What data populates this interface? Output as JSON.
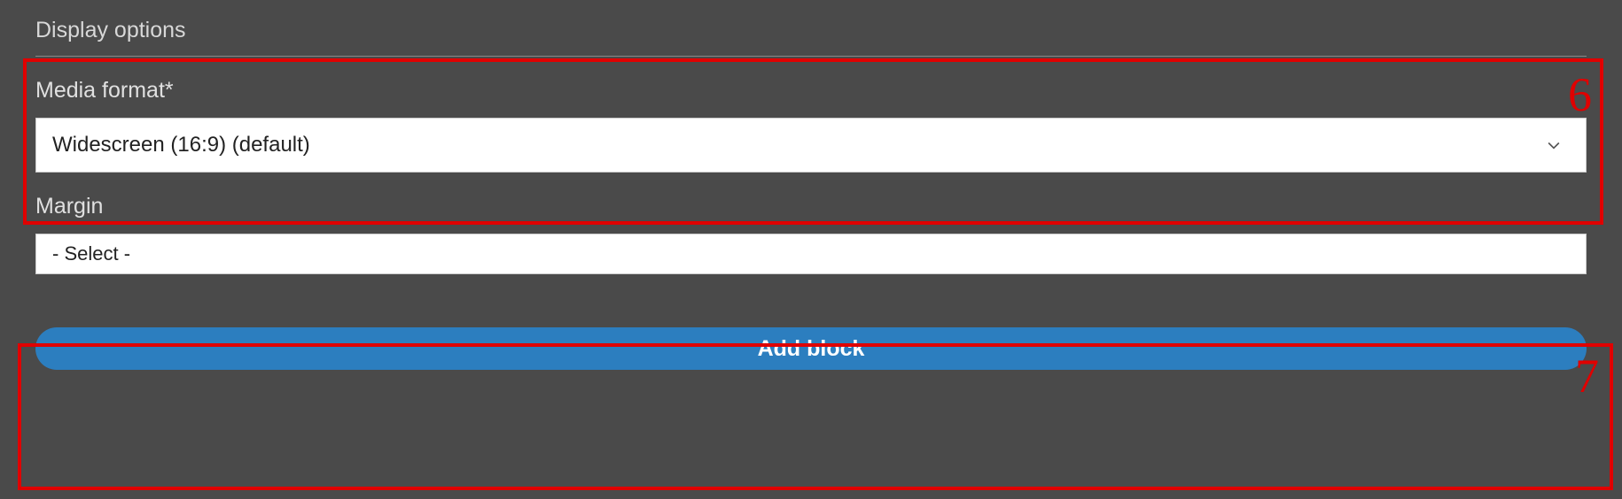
{
  "section": {
    "title": "Display options"
  },
  "fields": {
    "media_format": {
      "label": "Media format*",
      "value": "Widescreen (16:9) (default)"
    },
    "margin": {
      "label": "Margin",
      "value": "- Select -"
    }
  },
  "actions": {
    "add_block_label": "Add block"
  },
  "annotations": {
    "num6": "6",
    "num7": "7"
  }
}
